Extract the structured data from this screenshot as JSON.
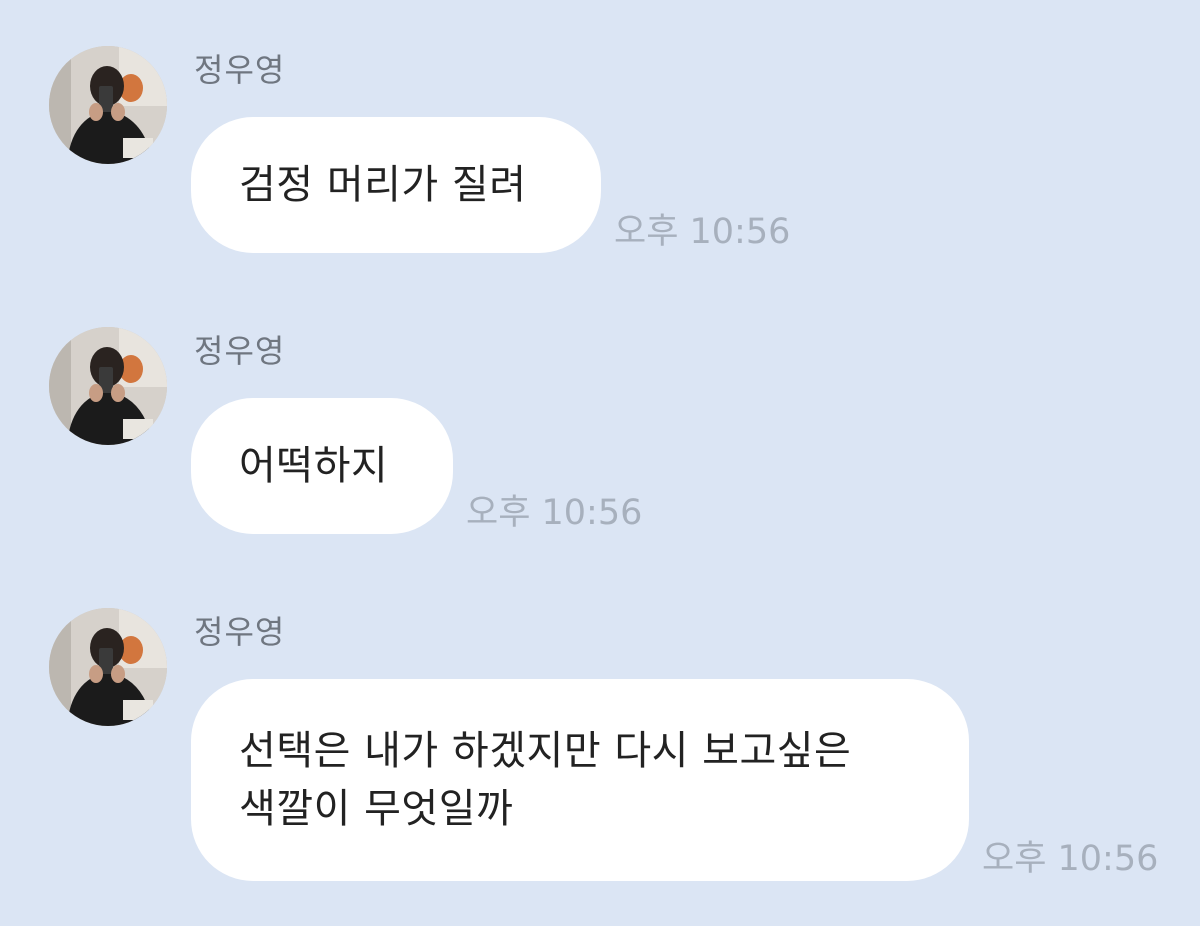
{
  "colors": {
    "background": "#dbe5f4",
    "bubble": "#ffffff",
    "sender_text": "#6f7680",
    "message_text": "#222222",
    "timestamp_text": "#a7b0bd"
  },
  "messages": [
    {
      "sender": "정우영",
      "avatar_icon": "profile-photo-avatar",
      "lines": [
        "검정 머리가 질려"
      ],
      "time": "오후 10:56"
    },
    {
      "sender": "정우영",
      "avatar_icon": "profile-photo-avatar",
      "lines": [
        "어떡하지"
      ],
      "time": "오후 10:56"
    },
    {
      "sender": "정우영",
      "avatar_icon": "profile-photo-avatar",
      "lines": [
        "선택은 내가 하겠지만 다시 보고싶은",
        "색깔이 무엇일까"
      ],
      "time": "오후 10:56"
    }
  ]
}
